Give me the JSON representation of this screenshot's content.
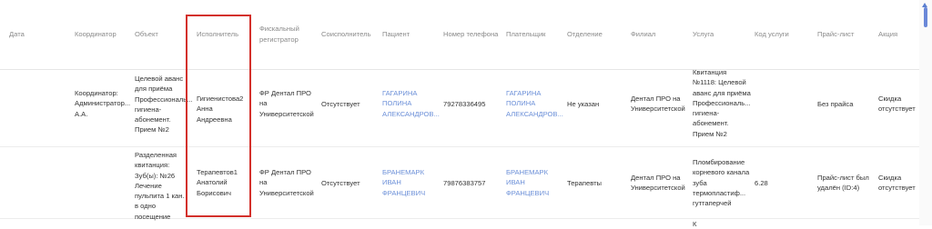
{
  "headers": {
    "date": "Дата",
    "coordinator": "Координатор",
    "object": "Объект",
    "executor": "Исполнитель",
    "fiscal": "Фискальный регистратор",
    "coexecutor": "Соисполнитель",
    "patient": "Пациент",
    "phone": "Номер телефона",
    "payer": "Плательщик",
    "department": "Отделение",
    "branch": "Филиал",
    "service": "Услуга",
    "service_code": "Код услуги",
    "price_list": "Прайс-лист",
    "promo": "Акция"
  },
  "rows": [
    {
      "coordinator": "Координатор: Администратор... А.А.",
      "object": "Целевой аванс для приёма Профессиональ... гигиена- абонемент. Прием №2",
      "executor": "Гигиенистова2 Анна Андреевна",
      "fiscal": "ФР Дентал ПРО на Университетской",
      "coexecutor": "Отсутствует",
      "patient": "ГАГАРИНА ПОЛИНА АЛЕКСАНДРОВ...",
      "phone": "79278336495",
      "payer": "ГАГАРИНА ПОЛИНА АЛЕКСАНДРОВ...",
      "department": "Не указан",
      "branch": "Дентал ПРО на Университетской",
      "service": "Квитанция №1118: Целевой аванс для приёма Профессиональ... гигиена- абонемент. Прием №2",
      "service_code": "",
      "price_list": "Без прайса",
      "promo": "Скидка отсутствует"
    },
    {
      "coordinator": "",
      "object": "Разделенная квитанция: Зуб(ы): №26 Лечение пульпита 1 кан. в одно посещение",
      "executor": "Терапевтов1 Анатолий Борисович",
      "fiscal": "ФР Дентал ПРО на Университетской",
      "coexecutor": "Отсутствует",
      "patient": "БРАНЕМАРК ИВАН ФРАНЦЕВИЧ",
      "phone": "79876383757",
      "payer": "БРАНЕМАРК ИВАН ФРАНЦЕВИЧ",
      "department": "Терапевты",
      "branch": "Дентал ПРО на Университетской",
      "service": "Пломбирование корневого канала зуба термопластиф... гуттаперчей",
      "service_code": "6.28",
      "price_list": "Прайс-лист был удалён (ID:4)",
      "promo": "Скидка отсутствует"
    }
  ],
  "partial_row": {
    "service_fragment": "К"
  }
}
